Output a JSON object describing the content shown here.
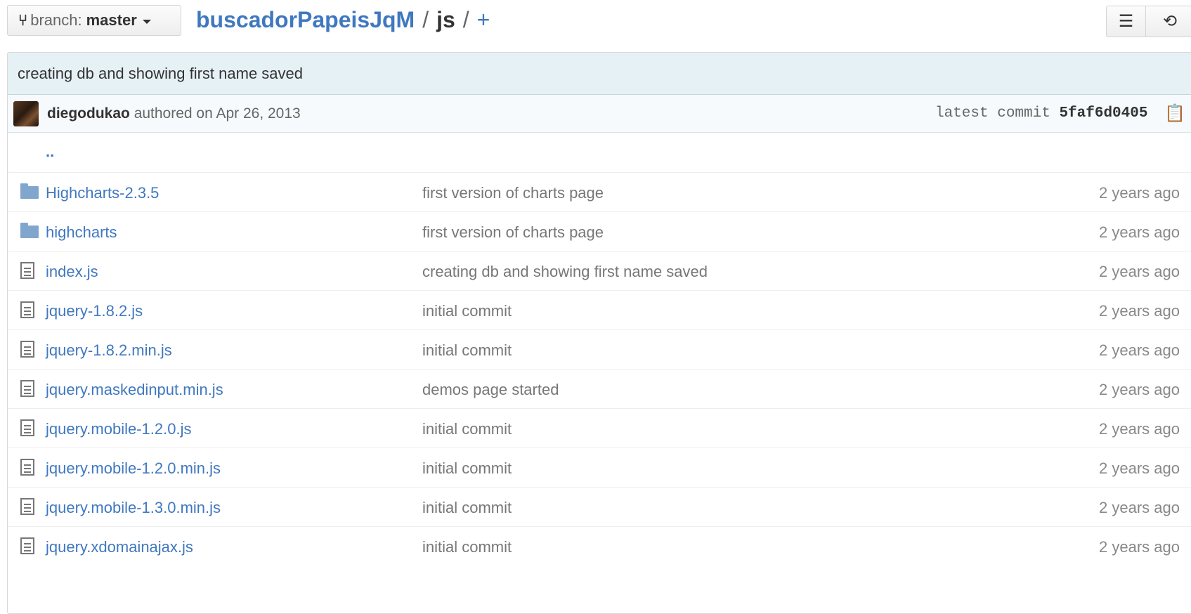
{
  "toolbar": {
    "branch_prefix": "branch:",
    "branch_name": "master",
    "repo": "buscadorPapeisJqM",
    "separator": "/",
    "current_dir": "js",
    "add_file": "+"
  },
  "commit": {
    "message": "creating db and showing first name saved",
    "author": "diegodukao",
    "authored_text": "authored on Apr 26, 2013",
    "latest_label": "latest commit",
    "sha": "5faf6d0405"
  },
  "parent_link": "..",
  "files": [
    {
      "type": "dir",
      "name": "Highcharts-2.3.5",
      "message": "first version of charts page",
      "age": "2 years ago"
    },
    {
      "type": "dir",
      "name": "highcharts",
      "message": "first version of charts page",
      "age": "2 years ago"
    },
    {
      "type": "file",
      "name": "index.js",
      "message": "creating db and showing first name saved",
      "age": "2 years ago"
    },
    {
      "type": "file",
      "name": "jquery-1.8.2.js",
      "message": "initial commit",
      "age": "2 years ago"
    },
    {
      "type": "file",
      "name": "jquery-1.8.2.min.js",
      "message": "initial commit",
      "age": "2 years ago"
    },
    {
      "type": "file",
      "name": "jquery.maskedinput.min.js",
      "message": "demos page started",
      "age": "2 years ago"
    },
    {
      "type": "file",
      "name": "jquery.mobile-1.2.0.js",
      "message": "initial commit",
      "age": "2 years ago"
    },
    {
      "type": "file",
      "name": "jquery.mobile-1.2.0.min.js",
      "message": "initial commit",
      "age": "2 years ago"
    },
    {
      "type": "file",
      "name": "jquery.mobile-1.3.0.min.js",
      "message": "initial commit",
      "age": "2 years ago"
    },
    {
      "type": "file",
      "name": "jquery.xdomainajax.js",
      "message": "initial commit",
      "age": "2 years ago"
    }
  ],
  "icons": {
    "branch": "branch-icon",
    "list": "list-icon",
    "history": "history-icon",
    "clipboard": "clipboard-icon",
    "directory": "folder-icon",
    "file": "file-icon"
  },
  "colors": {
    "link": "#4078c0",
    "commit_bar": "#e6f1f6",
    "folder": "#80a6cd"
  }
}
